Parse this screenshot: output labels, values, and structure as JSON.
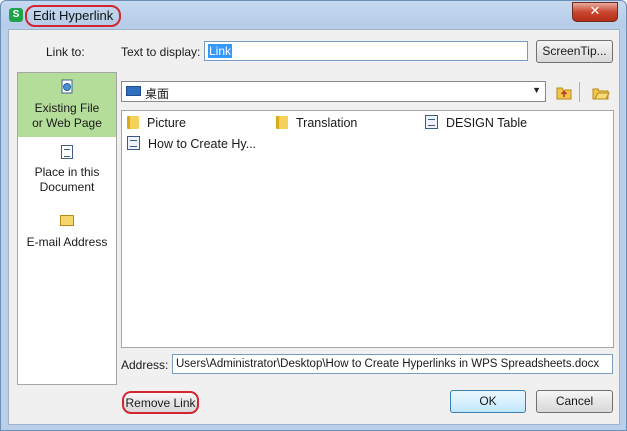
{
  "window": {
    "title": "Edit Hyperlink",
    "app_icon_glyph": "S",
    "close_glyph": "✕"
  },
  "link_to_label": "Link to:",
  "text_to_display": {
    "label": "Text to display:",
    "value": "Link"
  },
  "screentip_label": "ScreenTip...",
  "sidebar": {
    "items": [
      {
        "line1": "Existing File",
        "line2": "or Web Page",
        "icon": "document-globe-icon",
        "selected": true
      },
      {
        "line1": "Place in this",
        "line2": "Document",
        "icon": "document-icon",
        "selected": false
      },
      {
        "line1": "E-mail Address",
        "icon": "mail-icon",
        "selected": false
      }
    ]
  },
  "location": {
    "value": "桌面",
    "icon": "desktop-icon"
  },
  "files": [
    {
      "name": "Picture",
      "type": "folder"
    },
    {
      "name": "Translation",
      "type": "folder"
    },
    {
      "name": "DESIGN Table",
      "type": "document"
    },
    {
      "name": "How to Create Hy...",
      "type": "document"
    }
  ],
  "address": {
    "label": "Address:",
    "value": "Users\\Administrator\\Desktop\\How to Create Hyperlinks in WPS Spreadsheets.docx"
  },
  "buttons": {
    "remove_link": "Remove Link",
    "ok": "OK",
    "cancel": "Cancel"
  },
  "colors": {
    "selected_sidebar": "#b5dd9a",
    "highlight_ring": "#d2252f",
    "text_selection": "#3399ff"
  }
}
